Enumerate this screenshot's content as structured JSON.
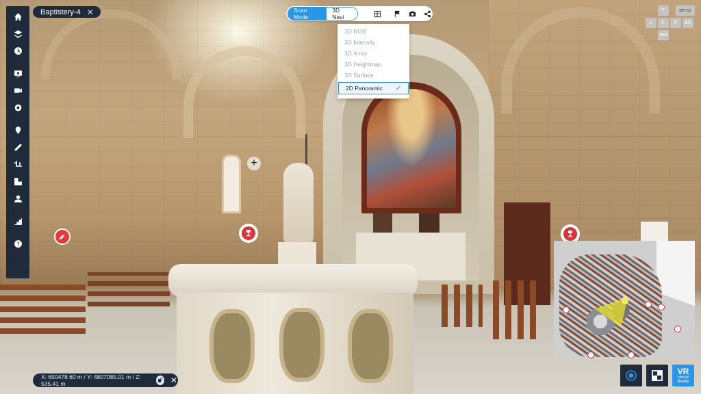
{
  "scan_tab": {
    "title": "Baptistery-4",
    "close": "✕"
  },
  "toolbar": {
    "mode_scan": "Scan Mode",
    "mode_3d": "3D Navi",
    "icons": [
      "grid-icon",
      "flag-icon",
      "camera-icon",
      "share-icon"
    ]
  },
  "view_menu": {
    "items": [
      {
        "label": "3D RGB",
        "selected": false
      },
      {
        "label": "3D Intensity",
        "selected": false
      },
      {
        "label": "3D X-ray",
        "selected": false
      },
      {
        "label": "3D Heightmap",
        "selected": false
      },
      {
        "label": "3D Surface",
        "selected": false
      },
      {
        "label": "2D Panoramic",
        "selected": true
      }
    ],
    "check": "✔"
  },
  "view_cube": {
    "top": "T",
    "left": "L",
    "front": "F",
    "right": "R",
    "back": "BK",
    "bottom": "BM",
    "persp": "persp"
  },
  "sidebar": {
    "icons": [
      "home-icon",
      "layers-icon",
      "clock-icon",
      "display-icon",
      "camera-move-icon",
      "settings-icon",
      "location-pin-icon",
      "ruler-icon",
      "crop-icon",
      "compare-icon",
      "group-icon",
      "stairs-icon",
      "help-icon"
    ]
  },
  "coords": {
    "text": "X: 650478.60 m / Y: 4807085.01 m / Z: 535.41 m",
    "close": "✕"
  },
  "vr_button": {
    "big": "VR",
    "small1": "Virtual",
    "small2": "Reality"
  },
  "colors": {
    "panel": "#1f2a3a",
    "accent": "#2b95e6",
    "marker_red": "#e23a3a"
  }
}
